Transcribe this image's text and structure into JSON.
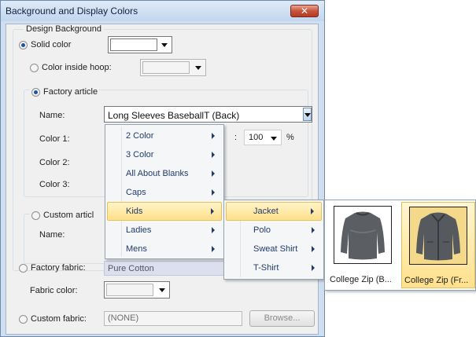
{
  "dialog": {
    "title": "Background and Display Colors",
    "close_glyph": "✕",
    "design_background": {
      "group_label": "Design Background",
      "solid_color_label": "Solid color",
      "color_inside_hoop_label": "Color inside hoop:",
      "factory_article": {
        "label": "Factory article",
        "name_label": "Name:",
        "name_value": "Long Sleeves BaseballT (Back)",
        "color1_label": "Color 1:",
        "color2_label": "Color 2:",
        "color3_label": "Color 3:",
        "color1_suffix": ":",
        "percent_value": "100",
        "percent_sign": "%"
      },
      "custom_article": {
        "label": "Custom articl",
        "name_label": "Name:"
      }
    },
    "factory_fabric": {
      "label": "Factory fabric:",
      "value": "Pure Cotton",
      "fabric_color_label": "Fabric color:"
    },
    "custom_fabric": {
      "label": "Custom fabric:",
      "value": "(NONE)",
      "browse_label": "Browse..."
    }
  },
  "menu1": {
    "items": [
      "2 Color",
      "3 Color",
      "All About Blanks",
      "Caps",
      "Kids",
      "Ladies",
      "Mens"
    ],
    "highlighted": "Kids"
  },
  "menu2": {
    "items": [
      "Jacket",
      "Polo",
      "Sweat Shirt",
      "T-Shirt"
    ],
    "highlighted": "Jacket"
  },
  "thumbnails": {
    "items": [
      "College Zip (B...",
      "College Zip (Fr..."
    ],
    "highlighted": "College Zip (Fr..."
  },
  "colors": {
    "title_bar": "#c2d6ee",
    "close_button": "#c7543b",
    "menu_highlight": "#ffe08a",
    "menu_text": "#213b6a"
  }
}
